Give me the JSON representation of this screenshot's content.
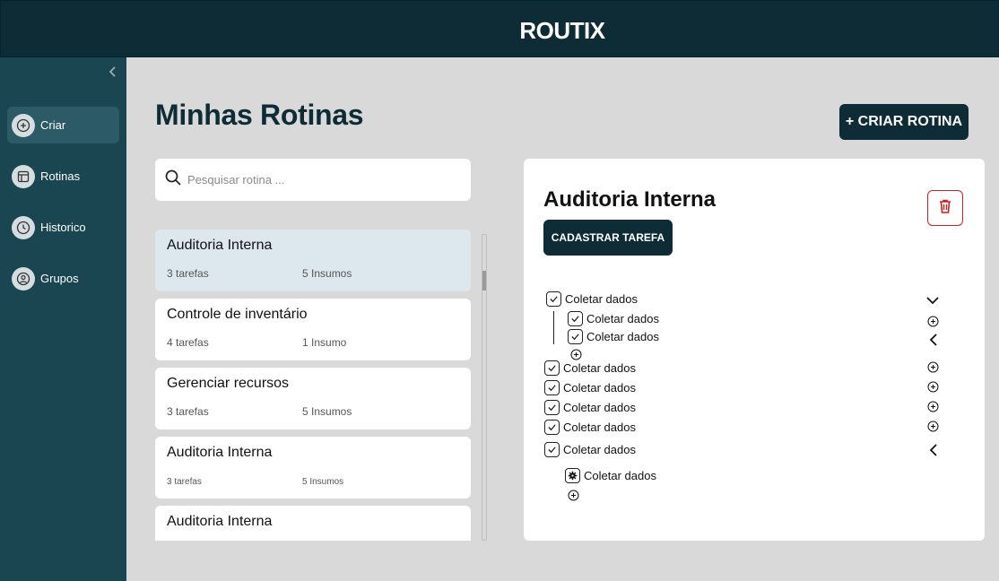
{
  "app": {
    "brand": "ROUTIX"
  },
  "sidebar": {
    "items": [
      {
        "label": "Criar",
        "icon": "plus-circle-icon",
        "active": true
      },
      {
        "label": "Rotinas",
        "icon": "table-icon",
        "active": false
      },
      {
        "label": "Historico",
        "icon": "clock-icon",
        "active": false
      },
      {
        "label": "Grupos",
        "icon": "user-icon",
        "active": false
      }
    ]
  },
  "main": {
    "title": "Minhas Rotinas",
    "create_button": "+ CRIAR ROTINA",
    "search": {
      "placeholder": "Pesquisar rotina ...",
      "value": ""
    },
    "routines": [
      {
        "title": "Auditoria Interna",
        "tasks": "3 tarefas",
        "inputs": "5 Insumos"
      },
      {
        "title": "Controle de inventário",
        "tasks": "4 tarefas",
        "inputs": "1 Insumo"
      },
      {
        "title": "Gerenciar recursos",
        "tasks": "3 tarefas",
        "inputs": "5 Insumos"
      },
      {
        "title": "Auditoria Interna",
        "tasks": "3 tarefas",
        "inputs": "5 Insumos"
      },
      {
        "title": "Auditoria Interna",
        "tasks": "",
        "inputs": ""
      }
    ]
  },
  "detail": {
    "title": "Auditoria Interna",
    "register_button": "CADASTRAR TAREFA",
    "tasks": [
      {
        "label": "Coletar dados"
      },
      {
        "label": "Coletar dados"
      },
      {
        "label": "Coletar dados"
      },
      {
        "label": "Coletar dados"
      },
      {
        "label": "Coletar dados"
      },
      {
        "label": "Coletar dados"
      },
      {
        "label": "Coletar dados"
      },
      {
        "label": "Coletar dados"
      },
      {
        "label": "Coletar dados"
      }
    ]
  },
  "colors": {
    "primary": "#0d2c35",
    "sidebar": "#1a4652",
    "danger": "#d21f1f",
    "selected": "#dde8ee"
  }
}
